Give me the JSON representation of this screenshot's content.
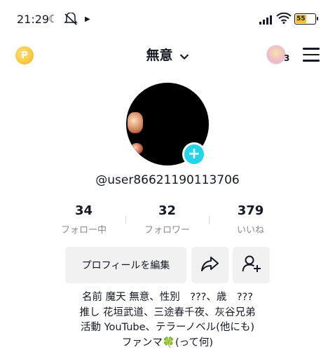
{
  "status_bar": {
    "time": "21:29",
    "battery_level": "55",
    "icons": [
      "moon-icon",
      "mute-icon",
      "play-icon",
      "signal-icon",
      "wifi-icon",
      "battery-icon"
    ]
  },
  "header": {
    "coin_glyph": "P",
    "username": "無意",
    "account_count": "3"
  },
  "profile": {
    "handle": "@user86621190113706",
    "add_glyph": "+"
  },
  "stats": [
    {
      "value": "34",
      "label": "フォロー中"
    },
    {
      "value": "32",
      "label": "フォロワー"
    },
    {
      "value": "379",
      "label": "いいね"
    }
  ],
  "actions": {
    "edit_label": "プロフィールを編集"
  },
  "bio": {
    "lines": [
      "名前 魔天 無意、性別　???、歳　???",
      "推し 花垣武道、三途春千夜、灰谷兄弟",
      "活動 YouTube、テラーノベル(他にも)",
      "ファンマ🍀(って何)"
    ]
  },
  "colors": {
    "accent": "#20d5ec",
    "battery": "#f2c230",
    "button_bg": "#f1f1f2",
    "muted_text": "#8a8b91"
  }
}
